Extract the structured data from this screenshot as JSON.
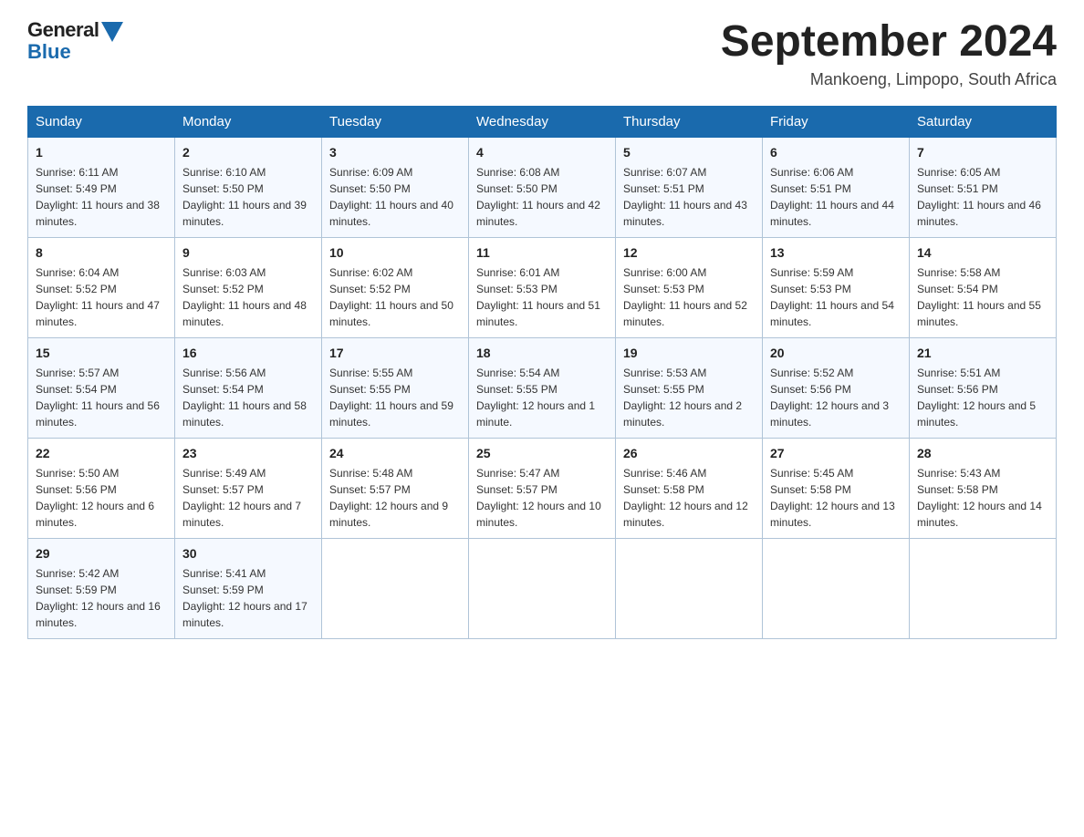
{
  "logo": {
    "general": "General",
    "blue": "Blue"
  },
  "header": {
    "month_year": "September 2024",
    "location": "Mankoeng, Limpopo, South Africa"
  },
  "days_of_week": [
    "Sunday",
    "Monday",
    "Tuesday",
    "Wednesday",
    "Thursday",
    "Friday",
    "Saturday"
  ],
  "weeks": [
    [
      {
        "day": "1",
        "sunrise": "6:11 AM",
        "sunset": "5:49 PM",
        "daylight": "11 hours and 38 minutes."
      },
      {
        "day": "2",
        "sunrise": "6:10 AM",
        "sunset": "5:50 PM",
        "daylight": "11 hours and 39 minutes."
      },
      {
        "day": "3",
        "sunrise": "6:09 AM",
        "sunset": "5:50 PM",
        "daylight": "11 hours and 40 minutes."
      },
      {
        "day": "4",
        "sunrise": "6:08 AM",
        "sunset": "5:50 PM",
        "daylight": "11 hours and 42 minutes."
      },
      {
        "day": "5",
        "sunrise": "6:07 AM",
        "sunset": "5:51 PM",
        "daylight": "11 hours and 43 minutes."
      },
      {
        "day": "6",
        "sunrise": "6:06 AM",
        "sunset": "5:51 PM",
        "daylight": "11 hours and 44 minutes."
      },
      {
        "day": "7",
        "sunrise": "6:05 AM",
        "sunset": "5:51 PM",
        "daylight": "11 hours and 46 minutes."
      }
    ],
    [
      {
        "day": "8",
        "sunrise": "6:04 AM",
        "sunset": "5:52 PM",
        "daylight": "11 hours and 47 minutes."
      },
      {
        "day": "9",
        "sunrise": "6:03 AM",
        "sunset": "5:52 PM",
        "daylight": "11 hours and 48 minutes."
      },
      {
        "day": "10",
        "sunrise": "6:02 AM",
        "sunset": "5:52 PM",
        "daylight": "11 hours and 50 minutes."
      },
      {
        "day": "11",
        "sunrise": "6:01 AM",
        "sunset": "5:53 PM",
        "daylight": "11 hours and 51 minutes."
      },
      {
        "day": "12",
        "sunrise": "6:00 AM",
        "sunset": "5:53 PM",
        "daylight": "11 hours and 52 minutes."
      },
      {
        "day": "13",
        "sunrise": "5:59 AM",
        "sunset": "5:53 PM",
        "daylight": "11 hours and 54 minutes."
      },
      {
        "day": "14",
        "sunrise": "5:58 AM",
        "sunset": "5:54 PM",
        "daylight": "11 hours and 55 minutes."
      }
    ],
    [
      {
        "day": "15",
        "sunrise": "5:57 AM",
        "sunset": "5:54 PM",
        "daylight": "11 hours and 56 minutes."
      },
      {
        "day": "16",
        "sunrise": "5:56 AM",
        "sunset": "5:54 PM",
        "daylight": "11 hours and 58 minutes."
      },
      {
        "day": "17",
        "sunrise": "5:55 AM",
        "sunset": "5:55 PM",
        "daylight": "11 hours and 59 minutes."
      },
      {
        "day": "18",
        "sunrise": "5:54 AM",
        "sunset": "5:55 PM",
        "daylight": "12 hours and 1 minute."
      },
      {
        "day": "19",
        "sunrise": "5:53 AM",
        "sunset": "5:55 PM",
        "daylight": "12 hours and 2 minutes."
      },
      {
        "day": "20",
        "sunrise": "5:52 AM",
        "sunset": "5:56 PM",
        "daylight": "12 hours and 3 minutes."
      },
      {
        "day": "21",
        "sunrise": "5:51 AM",
        "sunset": "5:56 PM",
        "daylight": "12 hours and 5 minutes."
      }
    ],
    [
      {
        "day": "22",
        "sunrise": "5:50 AM",
        "sunset": "5:56 PM",
        "daylight": "12 hours and 6 minutes."
      },
      {
        "day": "23",
        "sunrise": "5:49 AM",
        "sunset": "5:57 PM",
        "daylight": "12 hours and 7 minutes."
      },
      {
        "day": "24",
        "sunrise": "5:48 AM",
        "sunset": "5:57 PM",
        "daylight": "12 hours and 9 minutes."
      },
      {
        "day": "25",
        "sunrise": "5:47 AM",
        "sunset": "5:57 PM",
        "daylight": "12 hours and 10 minutes."
      },
      {
        "day": "26",
        "sunrise": "5:46 AM",
        "sunset": "5:58 PM",
        "daylight": "12 hours and 12 minutes."
      },
      {
        "day": "27",
        "sunrise": "5:45 AM",
        "sunset": "5:58 PM",
        "daylight": "12 hours and 13 minutes."
      },
      {
        "day": "28",
        "sunrise": "5:43 AM",
        "sunset": "5:58 PM",
        "daylight": "12 hours and 14 minutes."
      }
    ],
    [
      {
        "day": "29",
        "sunrise": "5:42 AM",
        "sunset": "5:59 PM",
        "daylight": "12 hours and 16 minutes."
      },
      {
        "day": "30",
        "sunrise": "5:41 AM",
        "sunset": "5:59 PM",
        "daylight": "12 hours and 17 minutes."
      },
      null,
      null,
      null,
      null,
      null
    ]
  ],
  "labels": {
    "sunrise": "Sunrise:",
    "sunset": "Sunset:",
    "daylight": "Daylight:"
  }
}
